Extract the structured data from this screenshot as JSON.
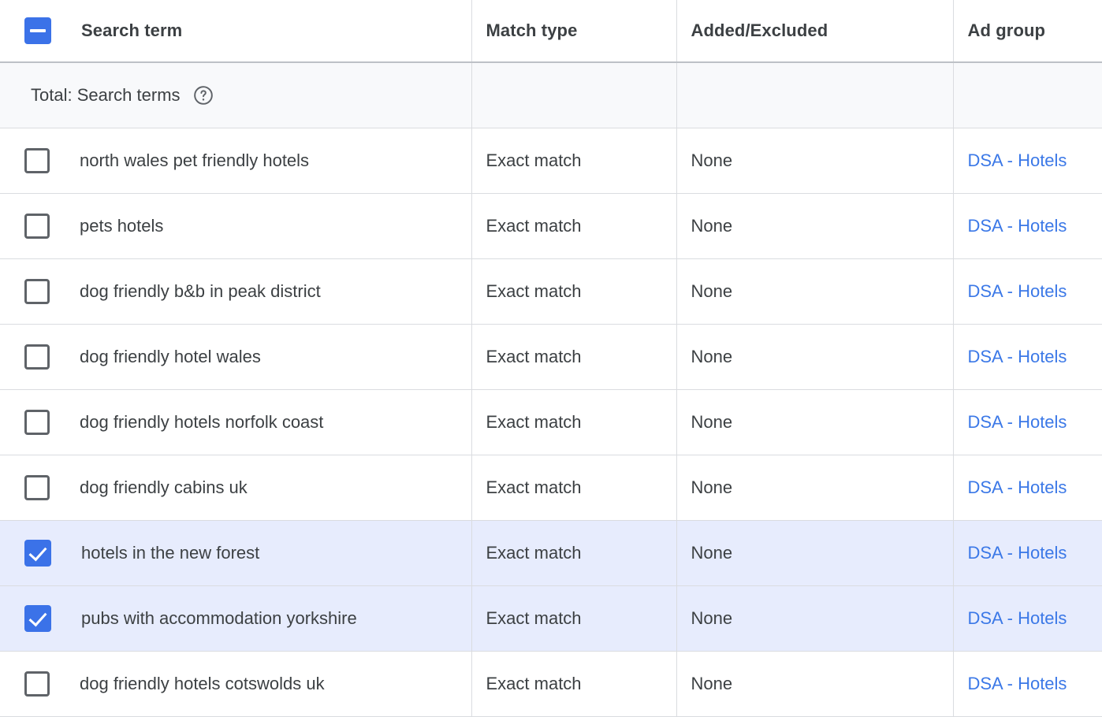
{
  "table": {
    "header": {
      "select_all_state": "indeterminate",
      "columns": [
        {
          "key": "search_term",
          "label": "Search term"
        },
        {
          "key": "match_type",
          "label": "Match type"
        },
        {
          "key": "added_excluded",
          "label": "Added/Excluded"
        },
        {
          "key": "ad_group",
          "label": "Ad group"
        }
      ]
    },
    "total_row": {
      "label": "Total: Search terms",
      "help_icon": "help-circle-icon",
      "match_type": "",
      "added_excluded": "",
      "ad_group": ""
    },
    "rows": [
      {
        "selected": false,
        "search_term": "north wales pet friendly hotels",
        "match_type": "Exact match",
        "added_excluded": "None",
        "ad_group": "DSA - Hotels"
      },
      {
        "selected": false,
        "search_term": "pets hotels",
        "match_type": "Exact match",
        "added_excluded": "None",
        "ad_group": "DSA - Hotels"
      },
      {
        "selected": false,
        "search_term": "dog friendly b&b in peak district",
        "match_type": "Exact match",
        "added_excluded": "None",
        "ad_group": "DSA - Hotels"
      },
      {
        "selected": false,
        "search_term": "dog friendly hotel wales",
        "match_type": "Exact match",
        "added_excluded": "None",
        "ad_group": "DSA - Hotels"
      },
      {
        "selected": false,
        "search_term": "dog friendly hotels norfolk coast",
        "match_type": "Exact match",
        "added_excluded": "None",
        "ad_group": "DSA - Hotels"
      },
      {
        "selected": false,
        "search_term": "dog friendly cabins uk",
        "match_type": "Exact match",
        "added_excluded": "None",
        "ad_group": "DSA - Hotels"
      },
      {
        "selected": true,
        "search_term": "hotels in the new forest",
        "match_type": "Exact match",
        "added_excluded": "None",
        "ad_group": "DSA - Hotels"
      },
      {
        "selected": true,
        "search_term": "pubs with accommodation yorkshire",
        "match_type": "Exact match",
        "added_excluded": "None",
        "ad_group": "DSA - Hotels"
      },
      {
        "selected": false,
        "search_term": "dog friendly hotels cotswolds uk",
        "match_type": "Exact match",
        "added_excluded": "None",
        "ad_group": "DSA - Hotels"
      }
    ]
  },
  "colors": {
    "accent": "#3b72e8",
    "link": "#3b78e7",
    "selected_row_bg": "#e7ecfd",
    "total_row_bg": "#f8f9fb",
    "text": "#3c4043",
    "border": "#dadce0",
    "header_border": "#bdc1c6",
    "checkbox_border": "#5f6368"
  }
}
